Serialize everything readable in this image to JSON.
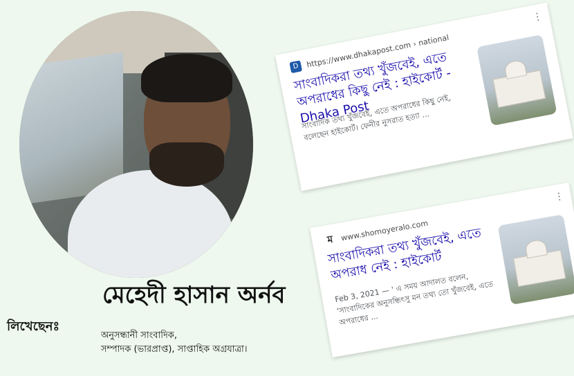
{
  "author": {
    "name": "মেহেদী হাসান অর্নব",
    "label": "লিখেছেনঃ",
    "desc_line1": "অনুসন্ধানী সাংবাদিক,",
    "desc_line2": "সম্পাদক (ভারপ্রাপ্ত), সাপ্তাহিক অগ্রযাত্রা।"
  },
  "results": [
    {
      "url": "https://www.dhakapost.com › national",
      "favicon": "D",
      "title": "সাংবাদিকরা তথ্য খুঁজবেই, এতে অপরাধের কিছু নেই : হাইকোর্ট - Dhaka Post",
      "snippet": "সাংবাদিক তথ্য খুঁজবেই, এতে অপরাধের কিছু নেই, বলেছেন হাইকোর্ট। ফেনীর নুসরাত হত্যা ...",
      "more_icon": "⋮"
    },
    {
      "url": "www.shomoyeralo.com",
      "favicon": "ম",
      "title": "সাংবাদিকরা তথ্য খুঁজবেই, এতে অপরাধ নেই : হাইকোর্ট",
      "snippet": "Feb 3, 2021 — ' এ সময় আদালত বলেন, 'সাংবাদিকের অনুসন্ধিৎসু মন তথ্য তো খুঁজবেই, এতে অপরাধের ...",
      "more_icon": "⋮"
    }
  ],
  "colors": {
    "background": "#eef8ee",
    "link": "#1a0dab"
  }
}
